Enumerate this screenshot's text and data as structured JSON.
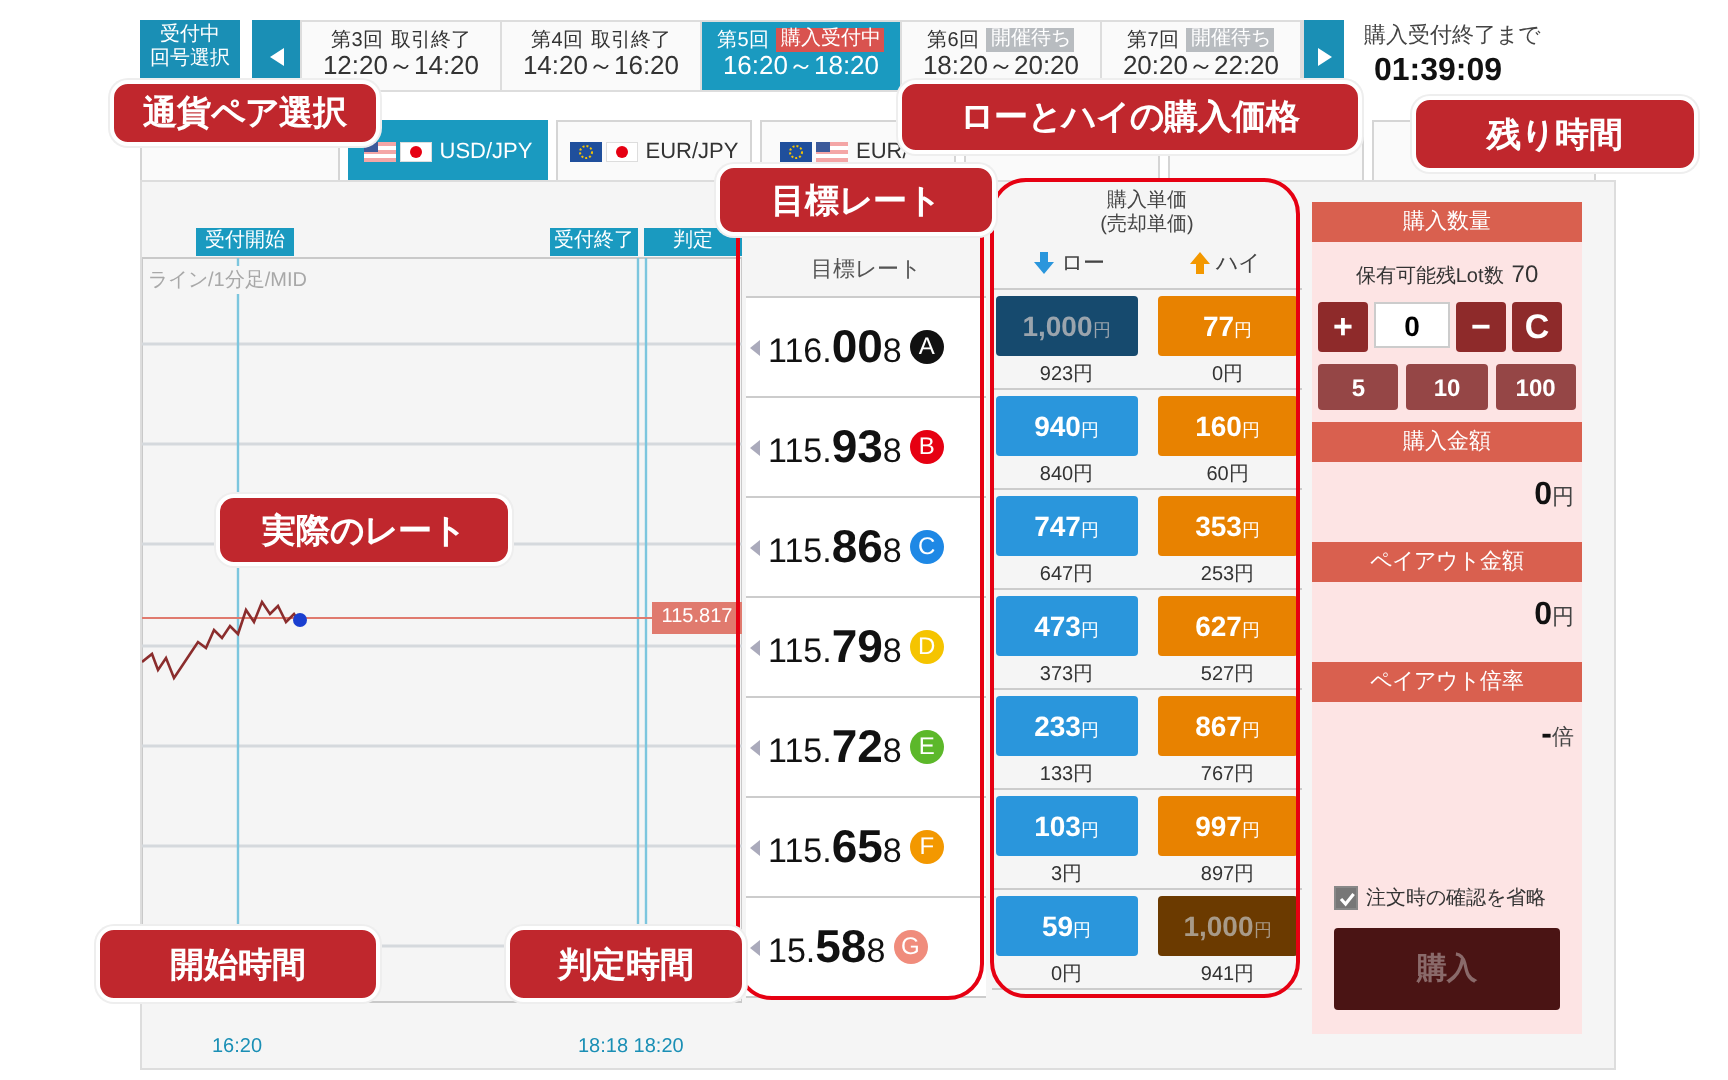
{
  "round_selector": {
    "label": "受付中",
    "sublabel": "回号選択"
  },
  "rounds": [
    {
      "number": "第3回",
      "status": {
        "text": "取引終了"
      },
      "time": "12:20～14:20",
      "selected": false
    },
    {
      "number": "第4回",
      "status": {
        "text": "取引終了"
      },
      "time": "14:20～16:20",
      "selected": false
    },
    {
      "number": "第5回",
      "status": {
        "text": "購入受付中",
        "color": "#d9534f"
      },
      "time": "16:20～18:20",
      "selected": true
    },
    {
      "number": "第6回",
      "status": {
        "text": "開催待ち",
        "color": "#b8bcc0"
      },
      "time": "18:20～20:20",
      "selected": false
    },
    {
      "number": "第7回",
      "status": {
        "text": "開催待ち",
        "color": "#b8bcc0"
      },
      "time": "20:20～22:20",
      "selected": false
    }
  ],
  "countdown": {
    "label": "購入受付終了まで",
    "time": "01:39:09"
  },
  "currency_tabs": [
    {
      "selected": false
    },
    {
      "label": "USD/JPY",
      "selected": true
    },
    {
      "label": "EUR/JPY",
      "selected": false
    },
    {
      "label": "EUR/",
      "selected": false
    },
    {
      "selected": false
    },
    {
      "selected": false
    },
    {
      "selected": false
    }
  ],
  "chart": {
    "markers": [
      "受付開始",
      "受付終了",
      "判定"
    ],
    "legend": "ライン/1分足/MID",
    "current_price": "115.817",
    "time_labels": [
      "16:20",
      "18:18 18:20"
    ]
  },
  "rate_table": {
    "header": "目標レート",
    "rows": [
      {
        "head": "116.",
        "big": "00",
        "tail": "8",
        "letter": "A",
        "color": "#111111"
      },
      {
        "head": "115.",
        "big": "93",
        "tail": "8",
        "letter": "B",
        "color": "#e60012"
      },
      {
        "head": "115.",
        "big": "86",
        "tail": "8",
        "letter": "C",
        "color": "#1e88e5"
      },
      {
        "head": "115.",
        "big": "79",
        "tail": "8",
        "letter": "D",
        "color": "#f5c400"
      },
      {
        "head": "115.",
        "big": "72",
        "tail": "8",
        "letter": "E",
        "color": "#5cb82a"
      },
      {
        "head": "115.",
        "big": "65",
        "tail": "8",
        "letter": "F",
        "color": "#f39800"
      },
      {
        "head": "15.",
        "big": "58",
        "tail": "8",
        "letter": "G",
        "color": "#f08c7c"
      }
    ]
  },
  "price_table": {
    "title": "購入単価",
    "subtitle": "(売却単価)",
    "low_label": "ロー",
    "high_label": "ハイ",
    "rows": [
      {
        "low": {
          "price": "1,000",
          "unit": "円",
          "sell": "923円",
          "disabled": true
        },
        "high": {
          "price": "77",
          "unit": "円",
          "sell": "0円",
          "disabled": false
        }
      },
      {
        "low": {
          "price": "940",
          "unit": "円",
          "sell": "840円",
          "disabled": false
        },
        "high": {
          "price": "160",
          "unit": "円",
          "sell": "60円",
          "disabled": false
        }
      },
      {
        "low": {
          "price": "747",
          "unit": "円",
          "sell": "647円",
          "disabled": false
        },
        "high": {
          "price": "353",
          "unit": "円",
          "sell": "253円",
          "disabled": false
        }
      },
      {
        "low": {
          "price": "473",
          "unit": "円",
          "sell": "373円",
          "disabled": false
        },
        "high": {
          "price": "627",
          "unit": "円",
          "sell": "527円",
          "disabled": false
        }
      },
      {
        "low": {
          "price": "233",
          "unit": "円",
          "sell": "133円",
          "disabled": false
        },
        "high": {
          "price": "867",
          "unit": "円",
          "sell": "767円",
          "disabled": false
        }
      },
      {
        "low": {
          "price": "103",
          "unit": "円",
          "sell": "3円",
          "disabled": false
        },
        "high": {
          "price": "997",
          "unit": "円",
          "sell": "897円",
          "disabled": false
        }
      },
      {
        "low": {
          "price": "59",
          "unit": "円",
          "sell": "0円",
          "disabled": false
        },
        "high": {
          "price": "1,000",
          "unit": "円",
          "sell": "941円",
          "disabled": true
        }
      }
    ]
  },
  "order_panel": {
    "quantity_header": "購入数量",
    "available_label": "保有可能残Lot数",
    "available_value": "70",
    "plus": "+",
    "quantity": "0",
    "minus": "−",
    "clear": "C",
    "presets": [
      "5",
      "10",
      "100"
    ],
    "sections": [
      {
        "header": "購入金額",
        "value": "0",
        "unit": "円"
      },
      {
        "header": "ペイアウト金額",
        "value": "0",
        "unit": "円"
      },
      {
        "header": "ペイアウト倍率",
        "value": "-",
        "unit": "倍"
      }
    ],
    "skip_confirm": {
      "label": "注文時の確認を省略",
      "checked": true
    },
    "buy_button": {
      "label": "購入",
      "disabled": true
    }
  },
  "callouts": [
    "通貨ペア選択",
    "ローとハイの購入価格",
    "残り時間",
    "目標レート",
    "実際のレート",
    "開始時間",
    "判定時間"
  ]
}
